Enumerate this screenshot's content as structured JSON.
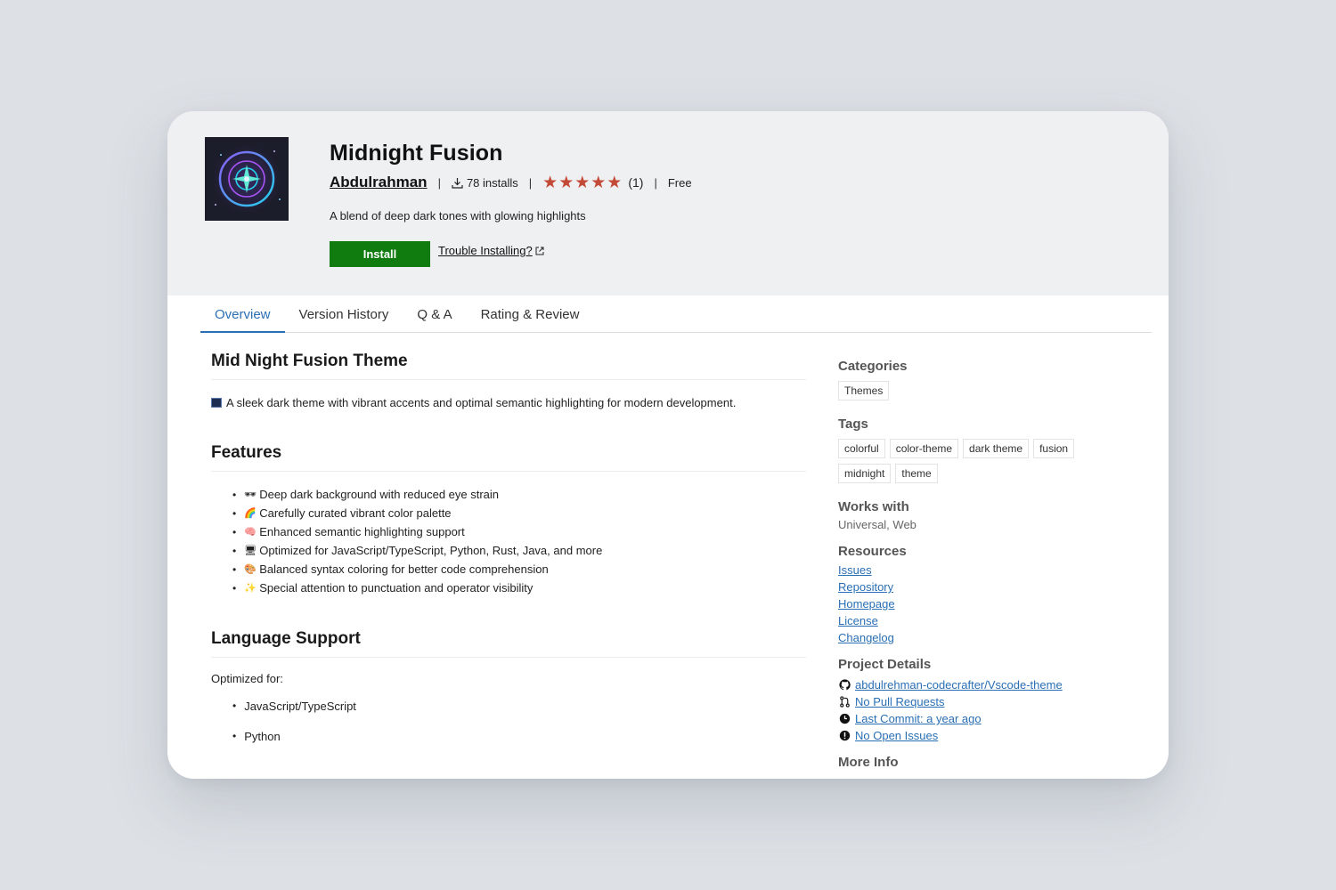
{
  "extension": {
    "title": "Midnight Fusion",
    "publisher": "Abdulrahman",
    "installs": "78 installs",
    "stars": "★★★★★",
    "rating_count": "(1)",
    "price": "Free",
    "description": "A blend of deep dark tones with glowing highlights",
    "install_label": "Install",
    "trouble_label": "Trouble Installing?",
    "rating_value": 5
  },
  "tabs": [
    {
      "label": "Overview",
      "active": true
    },
    {
      "label": "Version History"
    },
    {
      "label": "Q & A"
    },
    {
      "label": "Rating & Review"
    }
  ],
  "overview": {
    "heading": "Mid Night Fusion Theme",
    "intro": "A sleek dark theme with vibrant accents and optimal semantic highlighting for modern development.",
    "features_heading": "Features",
    "features": [
      {
        "emoji": "🕶",
        "text": "Deep dark background with reduced eye strain"
      },
      {
        "emoji": "🌈",
        "text": "Carefully curated vibrant color palette"
      },
      {
        "emoji": "🧠",
        "text": "Enhanced semantic highlighting support"
      },
      {
        "emoji": "🖥",
        "text": "Optimized for JavaScript/TypeScript, Python, Rust, Java, and more"
      },
      {
        "emoji": "🎨",
        "text": "Balanced syntax coloring for better code comprehension"
      },
      {
        "emoji": "✨",
        "text": "Special attention to punctuation and operator visibility"
      }
    ],
    "lang_heading": "Language Support",
    "lang_intro": "Optimized for:",
    "languages": [
      "JavaScript/TypeScript",
      "Python"
    ]
  },
  "sidebar": {
    "categories_heading": "Categories",
    "categories": [
      "Themes"
    ],
    "tags_heading": "Tags",
    "tags": [
      "colorful",
      "color-theme",
      "dark theme",
      "fusion",
      "midnight",
      "theme"
    ],
    "works_heading": "Works with",
    "works_value": "Universal, Web",
    "resources_heading": "Resources",
    "resources": [
      "Issues",
      "Repository",
      "Homepage",
      "License",
      "Changelog"
    ],
    "project_heading": "Project Details",
    "project": [
      {
        "icon": "github-icon",
        "text": "abdulrehman-codecrafter/Vscode-theme"
      },
      {
        "icon": "pull-request-icon",
        "text": "No Pull Requests"
      },
      {
        "icon": "clock-icon",
        "text": "Last Commit: a year ago"
      },
      {
        "icon": "alert-icon",
        "text": "No Open Issues"
      }
    ],
    "more_heading": "More Info"
  },
  "colors": {
    "install_button": "#107c10",
    "link": "#2a6fb4",
    "star": "#c44a38",
    "header_bg": "#eef0f2"
  }
}
